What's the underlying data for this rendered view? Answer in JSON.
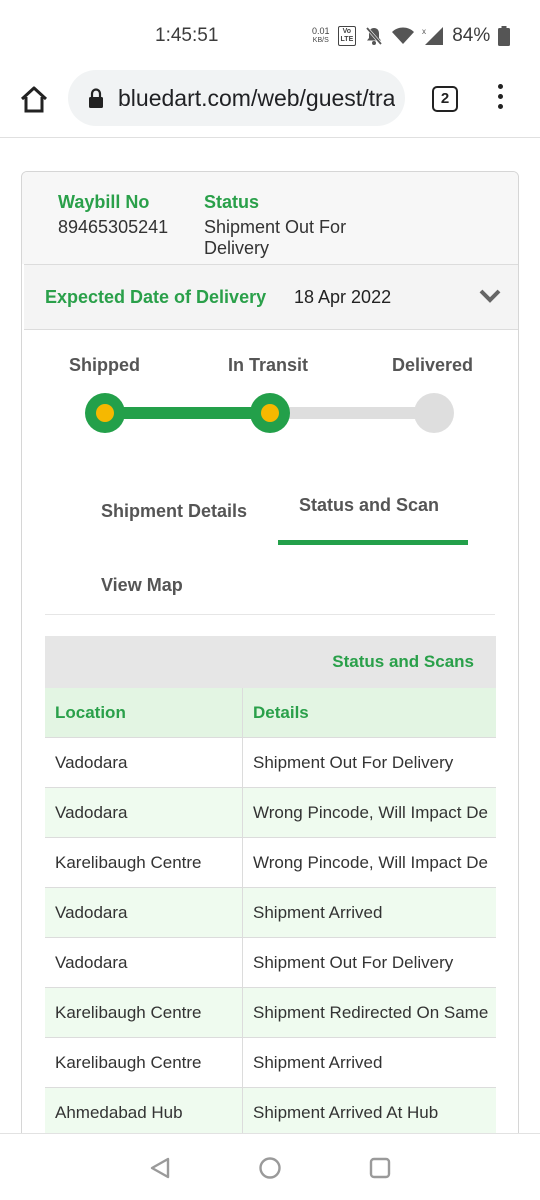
{
  "status_bar": {
    "time": "1:45:51",
    "net_speed_value": "0.01",
    "net_speed_unit": "KB/S",
    "volte_top": "Vo",
    "volte_bottom": "LTE",
    "battery": "84%"
  },
  "browser": {
    "url": "bluedart.com/web/guest/tra",
    "tab_count": "2"
  },
  "shipment": {
    "waybill_label": "Waybill No",
    "waybill_number": "89465305241",
    "status_label": "Status",
    "status_value": "Shipment Out For Delivery",
    "edd_label": "Expected Date of Delivery",
    "edd_value": "18 Apr 2022"
  },
  "progress": {
    "steps": [
      {
        "label": "Shipped",
        "done": true
      },
      {
        "label": "In Transit",
        "done": true
      },
      {
        "label": "Delivered",
        "done": false
      }
    ],
    "accent": "#23a04a",
    "dot_color": "#f6b800"
  },
  "tabs": {
    "shipment_details": "Shipment Details",
    "status_and_scan": "Status and Scan",
    "view_map": "View Map",
    "active": "Status and Scan"
  },
  "scan_table": {
    "caption": "Status and Scans",
    "headers": {
      "location": "Location",
      "details": "Details"
    },
    "rows": [
      {
        "location": "Vadodara",
        "details": "Shipment Out For Delivery"
      },
      {
        "location": "Vadodara",
        "details": "Wrong Pincode, Will Impact De"
      },
      {
        "location": "Karelibaugh Centre",
        "details": "Wrong Pincode, Will Impact De"
      },
      {
        "location": "Vadodara",
        "details": "Shipment Arrived"
      },
      {
        "location": "Vadodara",
        "details": "Shipment Out For Delivery"
      },
      {
        "location": "Karelibaugh Centre",
        "details": "Shipment Redirected On Same"
      },
      {
        "location": "Karelibaugh Centre",
        "details": "Shipment Arrived"
      },
      {
        "location": "Ahmedabad Hub",
        "details": "Shipment Arrived At Hub"
      }
    ]
  },
  "nav": {
    "back_icon": "back-triangle-icon",
    "home_icon": "home-circle-icon",
    "recents_icon": "recents-square-icon"
  }
}
